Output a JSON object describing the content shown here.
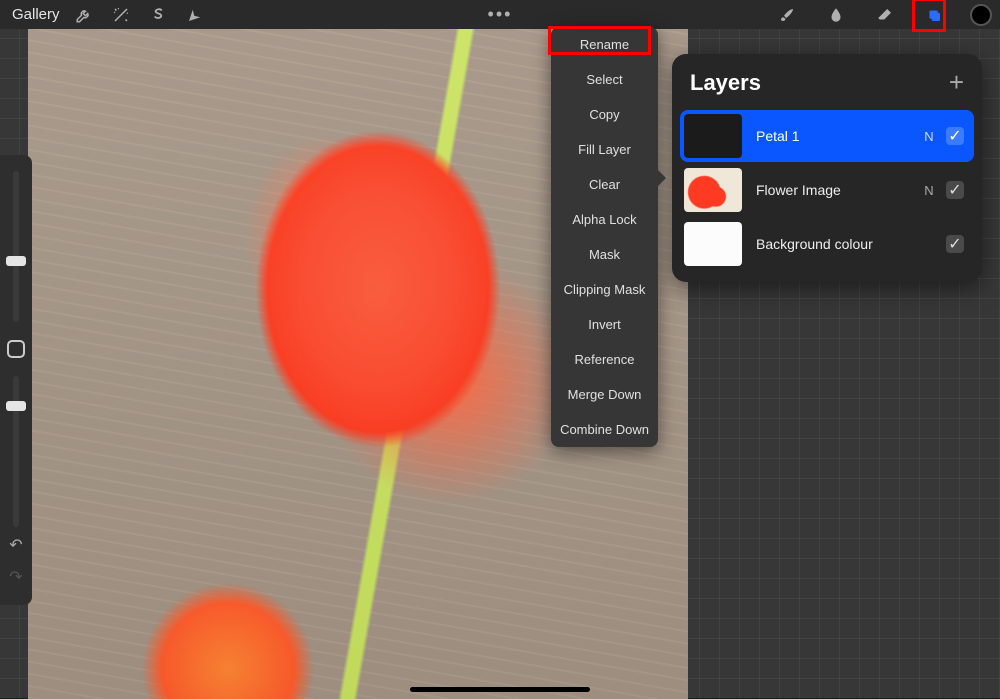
{
  "toolbar": {
    "gallery_label": "Gallery",
    "more_glyph": "•••"
  },
  "context_menu": {
    "items": [
      "Rename",
      "Select",
      "Copy",
      "Fill Layer",
      "Clear",
      "Alpha Lock",
      "Mask",
      "Clipping Mask",
      "Invert",
      "Reference",
      "Merge Down",
      "Combine Down"
    ]
  },
  "layers": {
    "title": "Layers",
    "add_glyph": "+",
    "items": [
      {
        "name": "Petal 1",
        "blend": "N",
        "visible": true,
        "selected": true,
        "thumb": "dark"
      },
      {
        "name": "Flower Image",
        "blend": "N",
        "visible": true,
        "selected": false,
        "thumb": "flower"
      },
      {
        "name": "Background colour",
        "blend": "",
        "visible": true,
        "selected": false,
        "thumb": "bg"
      }
    ]
  },
  "icons": {
    "check": "✓",
    "undo": "↶",
    "redo": "↷"
  }
}
